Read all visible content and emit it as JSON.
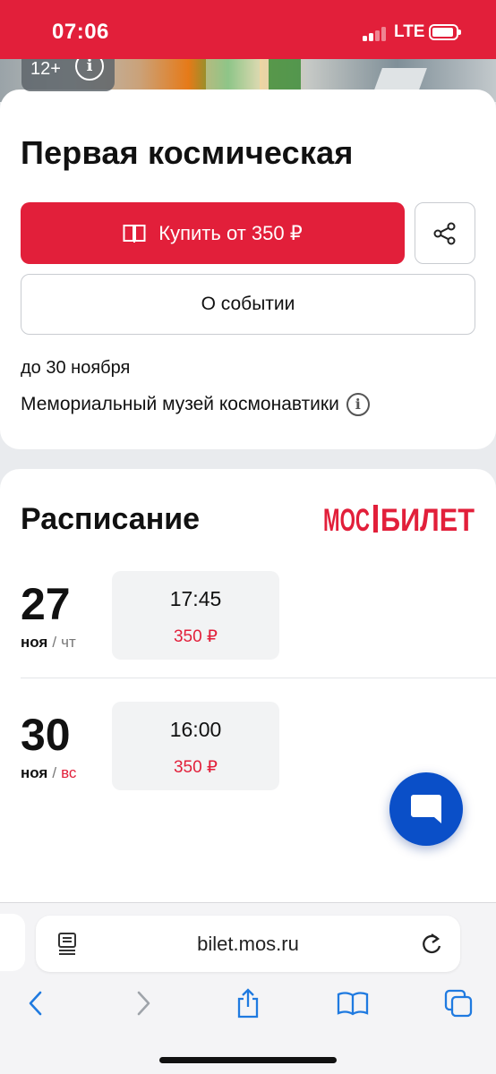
{
  "status_bar": {
    "time": "07:06",
    "network": "LTE"
  },
  "hero": {
    "age_rating": "12+"
  },
  "event": {
    "title": "Первая космическая",
    "buy_label": "Купить от 350 ₽",
    "about_label": "О событии",
    "date_until": "до 30 ноября",
    "venue": "Мемориальный музей космонавтики"
  },
  "schedule": {
    "title": "Расписание",
    "logo_text": "МОС БИЛЕТ",
    "rows": [
      {
        "day": "27",
        "month": "ноя",
        "weekday": "чт",
        "weekend": false,
        "time": "17:45",
        "price": "350 ₽"
      },
      {
        "day": "30",
        "month": "ноя",
        "weekday": "вс",
        "weekend": true,
        "time": "16:00",
        "price": "350 ₽"
      }
    ]
  },
  "browser": {
    "url": "bilet.mos.ru"
  },
  "colors": {
    "brand_red": "#e21f3a",
    "chat_blue": "#0a4fc8",
    "ios_blue": "#1f7ae0"
  },
  "icons": [
    "info-icon",
    "book-icon",
    "share-icon",
    "chat-icon",
    "reader-icon",
    "reload-icon",
    "back-icon",
    "forward-icon",
    "share-sheet-icon",
    "bookmarks-icon",
    "tabs-icon"
  ]
}
